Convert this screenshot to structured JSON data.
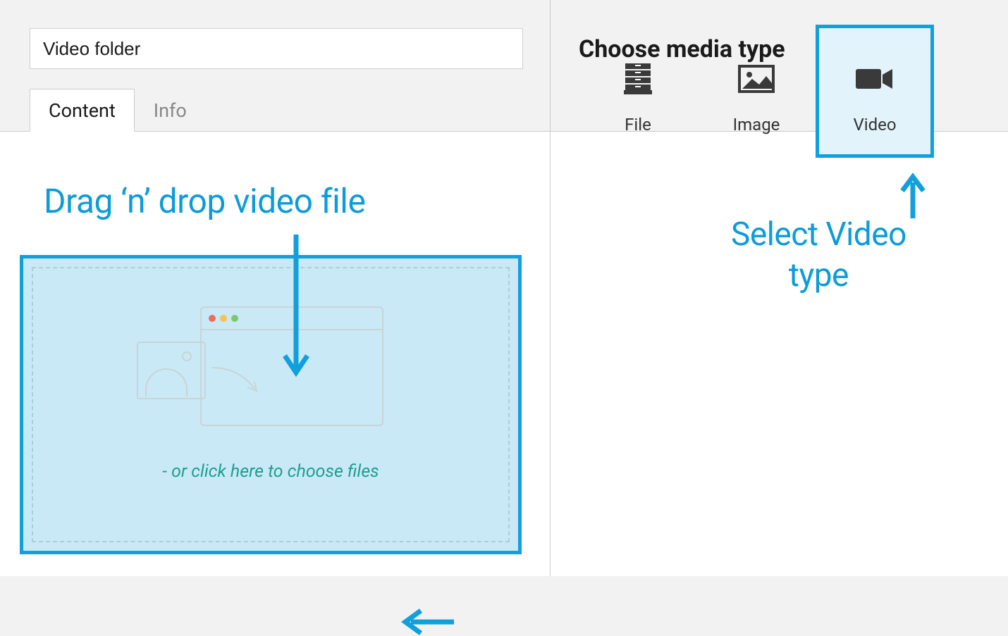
{
  "left": {
    "folder_name": "Video folder",
    "tabs": [
      {
        "label": "Content",
        "active": true
      },
      {
        "label": "Info",
        "active": false
      }
    ],
    "annotation_drag": "Drag ‘n’ drop video file",
    "click_text": "- or click here to choose files"
  },
  "right": {
    "header_title": "Choose media type",
    "media_types": [
      {
        "key": "file",
        "label": "File",
        "selected": false
      },
      {
        "key": "image",
        "label": "Image",
        "selected": false
      },
      {
        "key": "video",
        "label": "Video",
        "selected": true
      }
    ],
    "annotation_select": "Select Video type"
  },
  "colors": {
    "accent": "#11a0db",
    "annotation": "#0d9cd8",
    "teal": "#1f9e8e",
    "dropzone_bg": "#c9e9f7"
  }
}
